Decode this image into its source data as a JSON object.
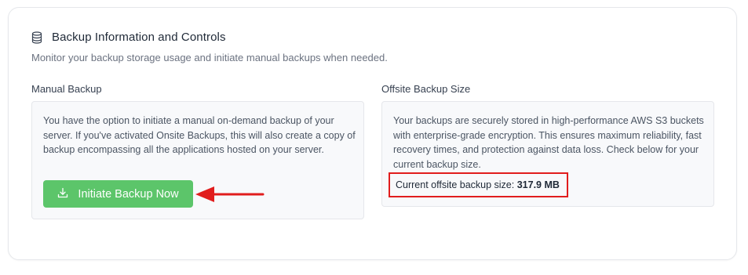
{
  "card": {
    "title": "Backup Information and Controls",
    "subtitle": "Monitor your backup storage usage and initiate manual backups when needed."
  },
  "manual_backup": {
    "label": "Manual Backup",
    "description": "You have the option to initiate a manual on-demand backup of your server. If you've activated Onsite Backups, this will also create a copy of backup encompassing all the applications hosted on your server.",
    "button_label": "Initiate Backup Now",
    "button_icon": "download-icon"
  },
  "offsite_backup": {
    "label": "Offsite Backup Size",
    "description": "Your backups are securely stored in high-performance AWS S3 buckets with enterprise-grade encryption. This ensures maximum reliability, fast recovery times, and protection against data loss. Check below for your current backup size.",
    "size_label": "Current offsite backup size:",
    "size_value": "317.9 MB"
  },
  "colors": {
    "button_green": "#5cc56a",
    "highlight_red": "#e11d1d",
    "arrow_red": "#e11d1d"
  }
}
